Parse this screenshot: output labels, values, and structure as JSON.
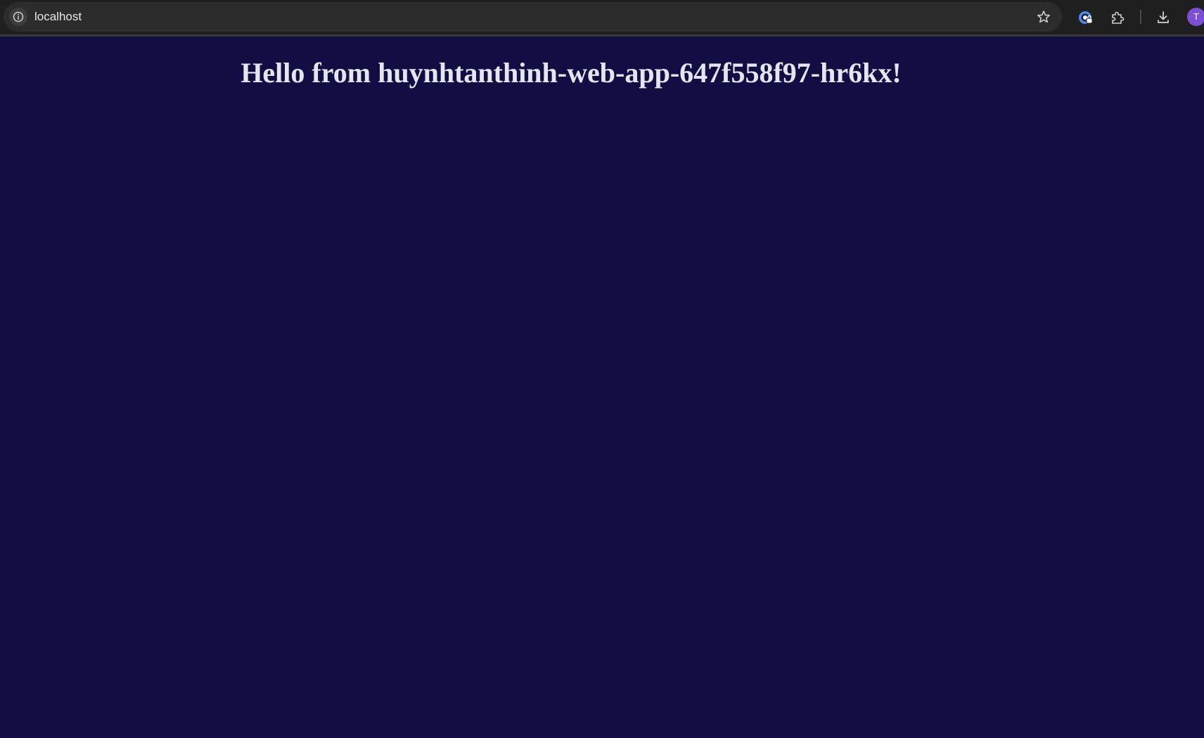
{
  "browser": {
    "url": "localhost",
    "icons": {
      "site_info": "info-icon",
      "bookmark": "star-icon",
      "extension_1": "password-manager-icon",
      "extensions": "puzzle-icon",
      "downloads": "download-icon"
    },
    "profile_initial": "T",
    "profile_color": "#7b4fd6"
  },
  "page": {
    "heading": "Hello from huynhtanthinh-web-app-647f558f97-hr6kx!",
    "background": "#120e43",
    "text_color": "#e6e4ef"
  }
}
